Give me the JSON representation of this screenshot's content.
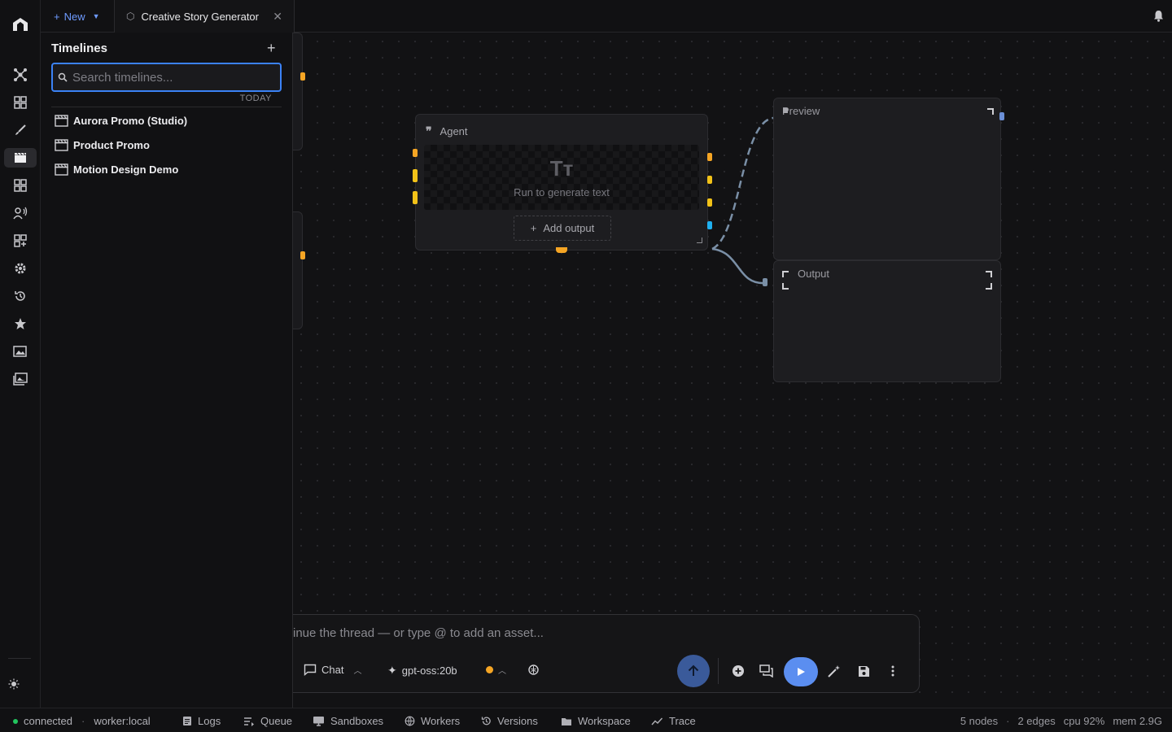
{
  "topbar": {
    "new_label": "New",
    "tab_title": "Creative Story Generator"
  },
  "sidebar": {
    "title": "Timelines",
    "search_placeholder": "Search timelines...",
    "group_label": "TODAY",
    "items": [
      {
        "label": "Aurora Promo (Studio)"
      },
      {
        "label": "Product Promo"
      },
      {
        "label": "Motion Design Demo"
      }
    ]
  },
  "nodes": {
    "agent": {
      "title": "Agent",
      "empty_text": "Run to generate text",
      "add_output": "Add output",
      "glyph": "Tт"
    },
    "preview": {
      "title": "Preview"
    },
    "output": {
      "title": "Output"
    }
  },
  "chat": {
    "placeholder": "inue the thread — or type @ to add an asset...",
    "mode_label": "Chat",
    "model_label": "gpt-oss:20b"
  },
  "statusbar": {
    "connection": "connected",
    "worker": "worker:local",
    "links": [
      "Logs",
      "Queue",
      "Sandboxes",
      "Workers",
      "Versions",
      "Workspace",
      "Trace"
    ],
    "nodes": "5 nodes",
    "edges": "2 edges",
    "cpu": "cpu 92%",
    "mem": "mem 2.9G"
  },
  "colors": {
    "accent": "#3b82f6",
    "port_orange": "#f5a524",
    "port_yellow": "#f2c218",
    "port_blue": "#1fb0f0",
    "edge": "#7a8fa6"
  }
}
